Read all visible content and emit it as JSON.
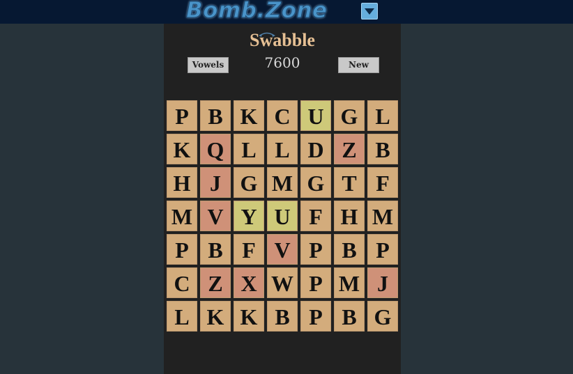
{
  "site": {
    "logo": "Bomb.Zone"
  },
  "game": {
    "title": "Swabble",
    "score": "7600",
    "vowels_label": "Vowels",
    "new_label": "New"
  },
  "colors": {
    "normal": "#d3ac7c",
    "red": "#cf9178",
    "yellow": "#cec979"
  },
  "board": {
    "rows": [
      [
        "P",
        "B",
        "K",
        "C",
        "U",
        "G",
        "L"
      ],
      [
        "K",
        "Q",
        "L",
        "L",
        "D",
        "Z",
        "B"
      ],
      [
        "H",
        "J",
        "G",
        "M",
        "G",
        "T",
        "F"
      ],
      [
        "M",
        "V",
        "Y",
        "U",
        "F",
        "H",
        "M"
      ],
      [
        "P",
        "B",
        "F",
        "V",
        "P",
        "B",
        "P"
      ],
      [
        "C",
        "Z",
        "X",
        "W",
        "P",
        "M",
        "J"
      ],
      [
        "L",
        "K",
        "K",
        "B",
        "P",
        "B",
        "G"
      ]
    ],
    "states": [
      [
        "n",
        "n",
        "n",
        "n",
        "y",
        "n",
        "n"
      ],
      [
        "n",
        "r",
        "n",
        "n",
        "n",
        "r",
        "n"
      ],
      [
        "n",
        "r",
        "n",
        "n",
        "n",
        "n",
        "n"
      ],
      [
        "n",
        "r",
        "y",
        "y",
        "n",
        "n",
        "n"
      ],
      [
        "n",
        "n",
        "n",
        "r",
        "n",
        "n",
        "n"
      ],
      [
        "n",
        "r",
        "r",
        "n",
        "n",
        "n",
        "r"
      ],
      [
        "n",
        "n",
        "n",
        "n",
        "n",
        "n",
        "n"
      ]
    ]
  }
}
